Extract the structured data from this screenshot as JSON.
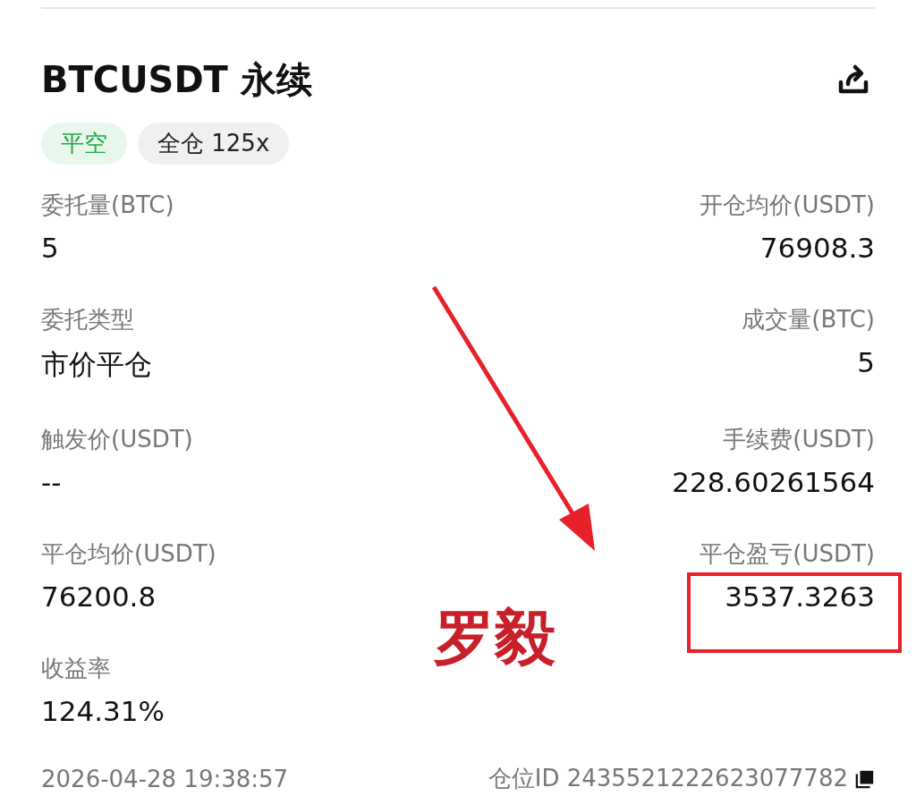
{
  "header": {
    "title": "BTCUSDT 永续"
  },
  "tags": [
    {
      "label": "平空",
      "kind": "positive"
    },
    {
      "label": "全仓 125x",
      "kind": "neutral"
    }
  ],
  "rows": [
    {
      "left": {
        "label": "委托量(BTC)",
        "value": "5"
      },
      "right": {
        "label": "开仓均价(USDT)",
        "value": "76908.3"
      }
    },
    {
      "left": {
        "label": "委托类型",
        "value": "市价平仓"
      },
      "right": {
        "label": "成交量(BTC)",
        "value": "5"
      }
    },
    {
      "left": {
        "label": "触发价(USDT)",
        "value": "--"
      },
      "right": {
        "label": "手续费(USDT)",
        "value": "228.60261564"
      }
    },
    {
      "left": {
        "label": "平仓均价(USDT)",
        "value": "76200.8"
      },
      "right": {
        "label": "平仓盈亏(USDT)",
        "value": "3537.3263"
      }
    },
    {
      "left": {
        "label": "收益率",
        "value": "124.31%"
      }
    }
  ],
  "footer": {
    "time": "2026-04-28 19:38:57",
    "position_id": "仓位ID 2435521222623077782"
  },
  "annotation": {
    "text": "罗毅"
  }
}
